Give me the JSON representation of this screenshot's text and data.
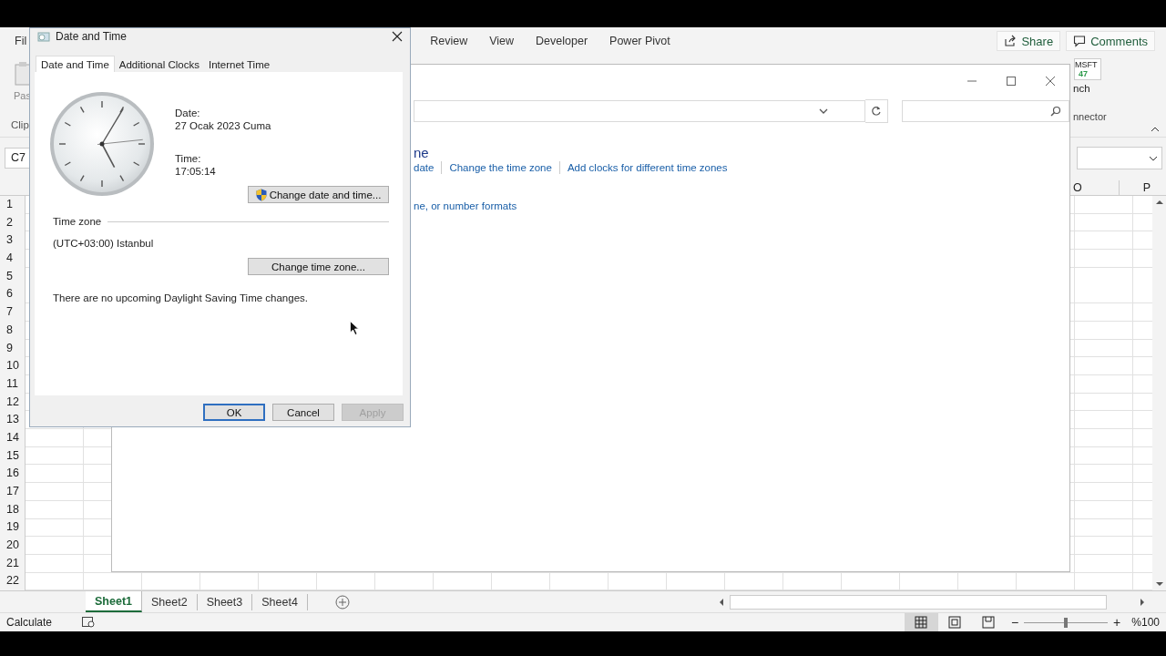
{
  "excel": {
    "ribbon_tabs_left": [
      "Fil"
    ],
    "ribbon_tabs": [
      "Review",
      "View",
      "Developer",
      "Power Pivot"
    ],
    "share_button": "Share",
    "comments_button": "Comments",
    "paste_label": "Pas",
    "clipboard_group": "Clip",
    "stock_tile": {
      "symbol": "MSFT",
      "value": "47"
    },
    "right_button": "nch",
    "right_group": "nnector",
    "name_box": "C7",
    "columns": [
      "O",
      "P"
    ],
    "rows": [
      "1",
      "2",
      "3",
      "4",
      "5",
      "6",
      "7",
      "8",
      "9",
      "10",
      "11",
      "12",
      "13",
      "14",
      "15",
      "16",
      "17",
      "18",
      "19",
      "20",
      "21",
      "22"
    ],
    "sheets": [
      {
        "label": "Sheet1",
        "selected": true
      },
      {
        "label": "Sheet2",
        "selected": false
      },
      {
        "label": "Sheet3",
        "selected": false
      },
      {
        "label": "Sheet4",
        "selected": false
      }
    ],
    "status": "Calculate",
    "views": [
      {
        "kind": "normal",
        "selected": true
      },
      {
        "kind": "page-layout",
        "selected": false
      },
      {
        "kind": "page-break",
        "selected": false
      }
    ],
    "zoom": {
      "minus": "−",
      "plus": "+",
      "label": "%100",
      "level": 0.5
    }
  },
  "control_panel": {
    "heading": "ne",
    "links": [
      "date",
      "Change the time zone",
      "Add clocks for different time zones"
    ],
    "sublink": "ne, or number formats"
  },
  "dialog": {
    "title": "Date and Time",
    "tabs": [
      {
        "label": "Date and Time",
        "selected": true
      },
      {
        "label": "Additional Clocks",
        "selected": false
      },
      {
        "label": "Internet Time",
        "selected": false
      }
    ],
    "date_label": "Date:",
    "date": "27 Ocak 2023 Cuma",
    "time_label": "Time:",
    "time": "17:05:14",
    "change_datetime": "Change date and time...",
    "timezone_label": "Time zone",
    "timezone": "(UTC+03:00) Istanbul",
    "change_timezone": "Change time zone...",
    "dst_note": "There are no upcoming Daylight Saving Time changes.",
    "buttons": [
      {
        "label": "OK",
        "default": true,
        "disabled": false
      },
      {
        "label": "Cancel",
        "default": false,
        "disabled": false
      },
      {
        "label": "Apply",
        "default": false,
        "disabled": true
      }
    ]
  }
}
